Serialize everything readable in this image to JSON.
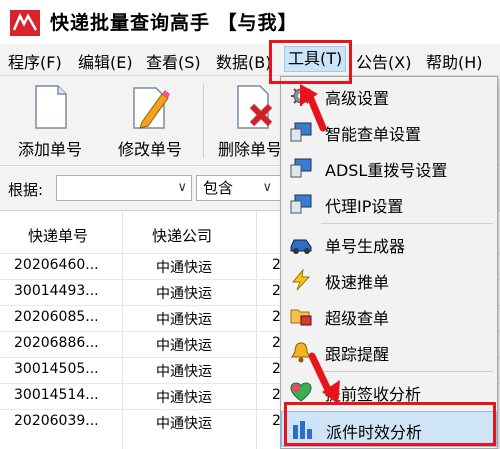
{
  "window": {
    "title": "快递批量查询高手 【与我】"
  },
  "menu": {
    "items": [
      {
        "label": "程序(F)",
        "key": "program"
      },
      {
        "label": "编辑(E)",
        "key": "edit"
      },
      {
        "label": "查看(S)",
        "key": "view"
      },
      {
        "label": "数据(B)",
        "key": "data"
      },
      {
        "label": "工具(T)",
        "key": "tools"
      },
      {
        "label": "公告(X)",
        "key": "notice"
      },
      {
        "label": "帮助(H)",
        "key": "help"
      }
    ]
  },
  "toolbar": {
    "add_label": "添加单号",
    "edit_label": "修改单号",
    "delete_label": "删除单号"
  },
  "filter": {
    "label": "根据:",
    "field_value": "",
    "mode_value": "包含"
  },
  "table": {
    "headers": [
      "快递单号",
      "快递公司"
    ],
    "rows": [
      [
        "20206460...",
        "中通快运",
        "2"
      ],
      [
        "30014493...",
        "中通快运",
        "2"
      ],
      [
        "20206085...",
        "中通快运",
        "2"
      ],
      [
        "20206886...",
        "中通快运",
        "2"
      ],
      [
        "30014505...",
        "中通快运",
        "2"
      ],
      [
        "30014514...",
        "中通快运",
        "2"
      ],
      [
        "20206039...",
        "中通快运",
        "2"
      ]
    ]
  },
  "tools_menu": {
    "items": [
      {
        "label": "高级设置",
        "icon": "gear-icon"
      },
      {
        "label": "智能查单设置",
        "icon": "monitor-settings-icon"
      },
      {
        "label": "ADSL重拨号设置",
        "icon": "monitor-dial-icon"
      },
      {
        "label": "代理IP设置",
        "icon": "monitor-proxy-icon"
      },
      {
        "label": "单号生成器",
        "icon": "car-icon"
      },
      {
        "label": "极速推单",
        "icon": "lightning-icon"
      },
      {
        "label": "超级查单",
        "icon": "folder-lock-icon"
      },
      {
        "label": "跟踪提醒",
        "icon": "bell-icon"
      },
      {
        "label": "提前签收分析",
        "icon": "heart-check-icon"
      },
      {
        "label": "派件时效分析",
        "icon": "bar-chart-icon"
      }
    ]
  },
  "colors": {
    "highlight_red": "#e8141b",
    "menu_highlight": "#cce4f7"
  }
}
